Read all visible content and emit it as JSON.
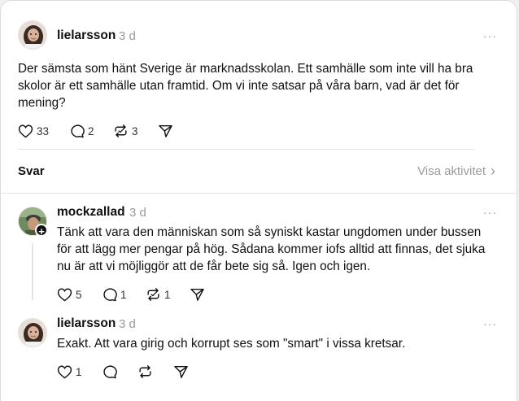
{
  "post": {
    "username": "lielarsson",
    "time": "3 d",
    "more": "···",
    "text": "Der sämsta som hänt Sverige är marknadsskolan. Ett samhälle som inte vill ha bra skolor är ett samhälle utan framtid. Om vi inte satsar på våra barn, vad är det för mening?",
    "likes": "33",
    "comments": "2",
    "reposts": "3"
  },
  "replies_header": {
    "label": "Svar",
    "activity_link": "Visa aktivitet",
    "chevron": "›"
  },
  "replies": [
    {
      "username": "mockzallad",
      "time": "3 d",
      "more": "···",
      "text": "Tänk att vara den människan som så syniskt kastar ungdomen under bussen för att lägg mer pengar på hög. Sådana kommer iofs alltid att finnas, det sjuka nu är att vi möjliggör att de får bete sig så. Igen och igen.",
      "likes": "5",
      "comments": "1",
      "reposts": "1",
      "badge": "+"
    },
    {
      "username": "lielarsson",
      "time": "3 d",
      "more": "···",
      "text": "Exakt. Att vara girig och korrupt ses som \"smart\" i vissa kretsar.",
      "likes": "1"
    }
  ],
  "icons": {
    "like": "heart-icon",
    "comment": "comment-icon",
    "repost": "repost-icon",
    "share": "send-icon",
    "more": "more-icon"
  }
}
